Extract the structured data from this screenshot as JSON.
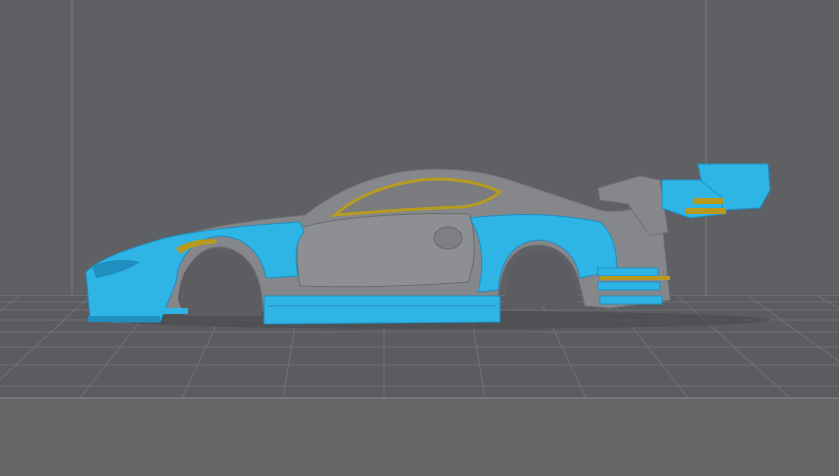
{
  "viewport": {
    "background_color": "#5f6063",
    "grid_color": "#77787b",
    "floor_band_color": "#6a6b6e"
  },
  "model": {
    "body_color": "#85878b",
    "panel_color": "#2fb4e6",
    "panel_shadow_color": "#1f8fbf",
    "support_color": "#b89a20",
    "tire_well_color": "#5c5d60"
  }
}
